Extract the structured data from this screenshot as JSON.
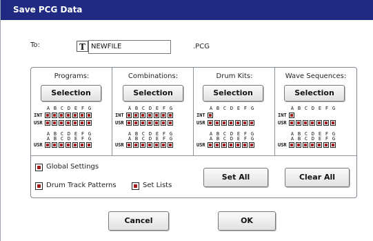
{
  "dialog": {
    "title": "Save PCG Data"
  },
  "file": {
    "to_label": "To:",
    "text_edit_icon": "T",
    "filename": "NEWFILE",
    "extension": ".PCG"
  },
  "columns": [
    {
      "header": "Programs:",
      "button": "Selection"
    },
    {
      "header": "Combinations:",
      "button": "Selection"
    },
    {
      "header": "Drum Kits:",
      "button": "Selection"
    },
    {
      "header": "Wave Sequences:",
      "button": "Selection"
    }
  ],
  "banks": {
    "letters": [
      "A",
      "B",
      "C",
      "D",
      "E",
      "F",
      "G"
    ],
    "int_label": "INT",
    "usr_label": "USR"
  },
  "options": {
    "global_settings": "Global Settings",
    "drum_track_patterns": "Drum Track Patterns",
    "set_lists": "Set Lists"
  },
  "actions": {
    "set_all": "Set All",
    "clear_all": "Clear All",
    "cancel": "Cancel",
    "ok": "OK"
  },
  "colors": {
    "title_bar": "#202a82",
    "check_fill": "#a31b1b"
  }
}
